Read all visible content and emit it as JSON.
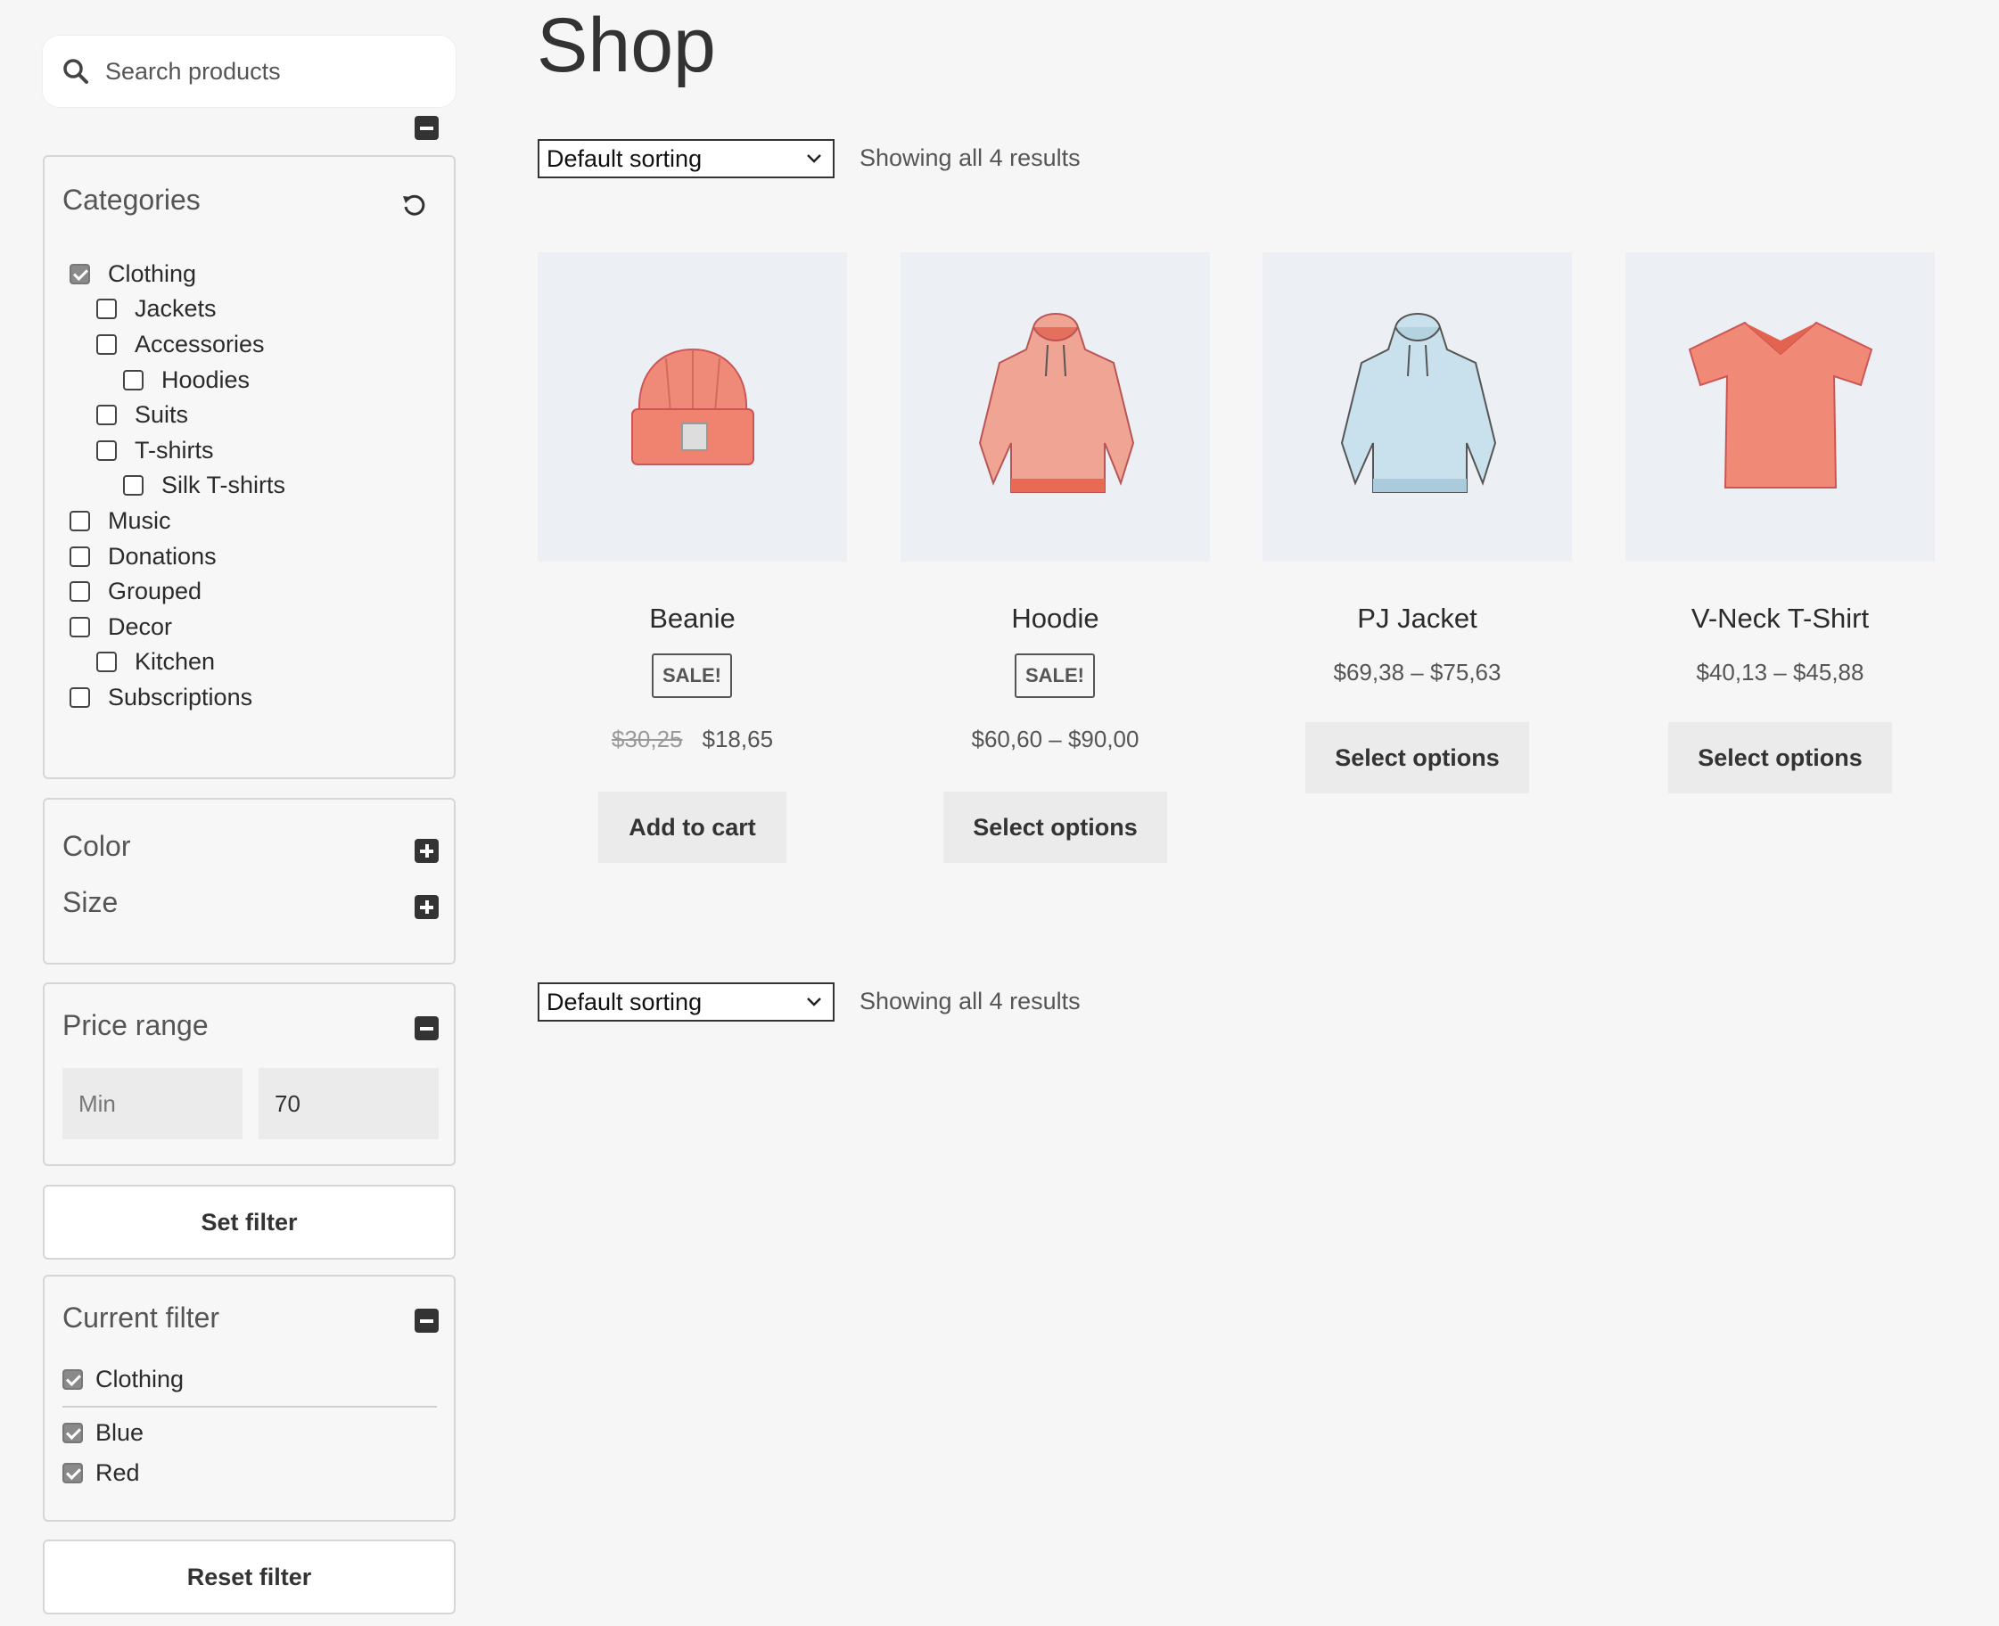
{
  "search": {
    "placeholder": "Search products"
  },
  "categories": {
    "title": "Categories",
    "items": [
      {
        "label": "Clothing",
        "checked": true
      },
      {
        "label": "Jackets",
        "checked": false
      },
      {
        "label": "Accessories",
        "checked": false
      },
      {
        "label": "Hoodies",
        "checked": false
      },
      {
        "label": "Suits",
        "checked": false
      },
      {
        "label": "T-shirts",
        "checked": false
      },
      {
        "label": "Silk T-shirts",
        "checked": false
      },
      {
        "label": "Music",
        "checked": false
      },
      {
        "label": "Donations",
        "checked": false
      },
      {
        "label": "Grouped",
        "checked": false
      },
      {
        "label": "Decor",
        "checked": false
      },
      {
        "label": "Kitchen",
        "checked": false
      },
      {
        "label": "Subscriptions",
        "checked": false
      }
    ]
  },
  "attributes": {
    "color_title": "Color",
    "size_title": "Size"
  },
  "price_range": {
    "title": "Price range",
    "min_placeholder": "Min",
    "max_value": "70"
  },
  "set_filter_label": "Set filter",
  "current_filter": {
    "title": "Current filter",
    "items": [
      "Clothing",
      "Blue",
      "Red"
    ]
  },
  "reset_filter_label": "Reset filter",
  "main": {
    "title": "Shop",
    "sorting": "Default sorting",
    "results": "Showing all 4 results"
  },
  "products": [
    {
      "name": "Beanie",
      "badge": "SALE!",
      "old_price": "$30,25",
      "price": "$18,65",
      "button": "Add to cart"
    },
    {
      "name": "Hoodie",
      "badge": "SALE!",
      "price": "$60,60 – $90,00",
      "button": "Select options"
    },
    {
      "name": "PJ Jacket",
      "price": "$69,38 – $75,63",
      "button": "Select options"
    },
    {
      "name": "V-Neck T-Shirt",
      "price": "$40,13 – $45,88",
      "button": "Select options"
    }
  ]
}
